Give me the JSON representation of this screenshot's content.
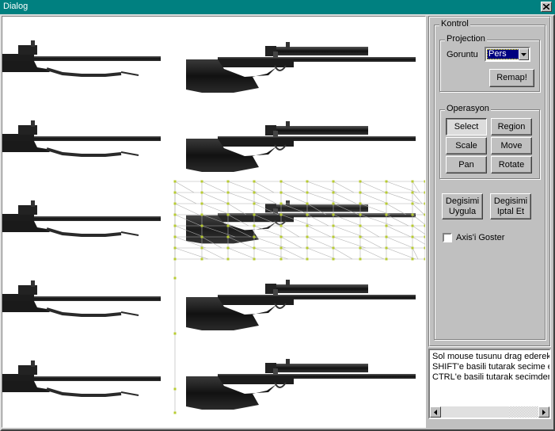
{
  "window": {
    "title": "Dialog",
    "close_icon": "close-x-icon"
  },
  "panel": {
    "group_title": "Kontrol",
    "projection": {
      "title": "Projection",
      "view_label": "Goruntu",
      "view_value": "Pers",
      "remap_label": "Remap!"
    },
    "operation": {
      "title": "Operasyon",
      "buttons": [
        {
          "label": "Select",
          "pressed": true
        },
        {
          "label": "Region",
          "pressed": false
        },
        {
          "label": "Scale",
          "pressed": false
        },
        {
          "label": "Move",
          "pressed": false
        },
        {
          "label": "Pan",
          "pressed": false
        },
        {
          "label": "Rotate",
          "pressed": false
        }
      ]
    },
    "apply": {
      "line1": "Degisimi",
      "line2": "Uygula"
    },
    "cancel": {
      "line1": "Degisimi",
      "line2": "Iptal Et"
    },
    "axis_checkbox_label": "Axis'i Goster",
    "axis_checked": false
  },
  "log": {
    "lines": [
      "Sol mouse tusunu drag ederek",
      "SHIFT'e basili tutarak secime e",
      "CTRL'e basili tutarak secimden"
    ]
  },
  "colors": {
    "titlebar": "#008080",
    "face": "#c0c0c0",
    "selection": "#000080",
    "grid": "#b0b0b0",
    "grid_points": "#b8cc30"
  }
}
